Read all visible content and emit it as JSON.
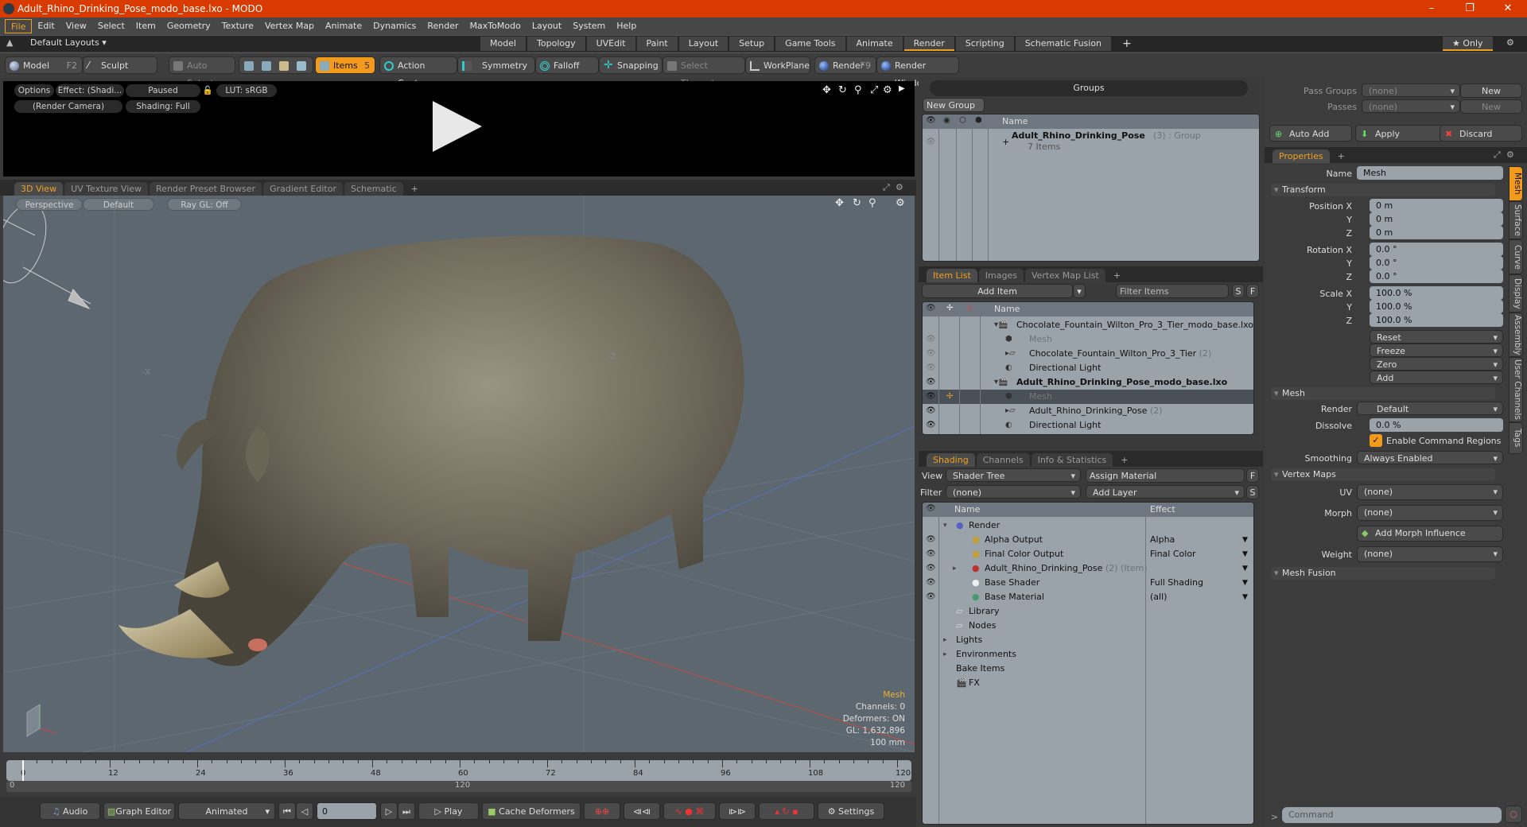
{
  "window": {
    "title": "Adult_Rhino_Drinking_Pose_modo_base.lxo - MODO",
    "controls": [
      "–",
      "❐",
      "✕"
    ]
  },
  "menu": [
    "File",
    "Edit",
    "View",
    "Select",
    "Item",
    "Geometry",
    "Texture",
    "Vertex Map",
    "Animate",
    "Dynamics",
    "Render",
    "MaxToModo",
    "Layout",
    "System",
    "Help"
  ],
  "layouts": {
    "label": "Default Layouts ▾",
    "tabs": [
      "Model",
      "Topology",
      "UVEdit",
      "Paint",
      "Layout",
      "Setup",
      "Game Tools",
      "Animate",
      "Render",
      "Scripting",
      "Schematic Fusion",
      "+"
    ],
    "active": "Render",
    "only_label": "★ Only"
  },
  "toolbar": {
    "model": "Model",
    "model_key": "F2",
    "sculpt": "Sculpt",
    "auto_select": "Auto Select",
    "items": "Items",
    "items_key": "5",
    "action_center": "Action Center",
    "symmetry": "Symmetry",
    "falloff": "Falloff",
    "snapping": "Snapping",
    "select_through": "Select Through",
    "workplane": "WorkPlane",
    "render": "Render",
    "render_key": "F9",
    "render_window": "Render Window"
  },
  "preview": {
    "options": "Options",
    "effect": "Effect: (Shadi...",
    "paused": "Paused",
    "lut": "LUT: sRGB",
    "camera": "(Render Camera)",
    "shading": "Shading: Full"
  },
  "viewport_tabs": [
    "3D View",
    "UV Texture View",
    "Render Preset Browser",
    "Gradient Editor",
    "Schematic",
    "+"
  ],
  "viewport": {
    "perspective": "Perspective",
    "default": "Default",
    "raygl": "Ray GL: Off",
    "axis_x_neg": "-X",
    "axis_z_neg": "-Z",
    "info": {
      "title": "Mesh",
      "channels": "Channels: 0",
      "deformers": "Deformers: ON",
      "gl": "GL: 1,632,896",
      "scale": "100 mm"
    }
  },
  "timeline": {
    "ticks": [
      "0",
      "12",
      "24",
      "36",
      "48",
      "60",
      "72",
      "84",
      "96",
      "108",
      "120"
    ],
    "range_start": "0",
    "range_mid": "120",
    "range_end": "120"
  },
  "transport": {
    "audio": "Audio",
    "graph_editor": "Graph Editor",
    "animated": "Animated",
    "frame": "0",
    "play": "Play",
    "cache_deformers": "Cache Deformers",
    "settings": "Settings"
  },
  "groups": {
    "title": "Groups",
    "new_group": "New Group",
    "name_header": "Name",
    "item_name": "Adult_Rhino_Drinking_Pose",
    "item_count": "(3)",
    "item_type": ": Group",
    "item_sub": "7 Items"
  },
  "item_list": {
    "tabs": [
      "Item List",
      "Images",
      "Vertex Map List",
      "+"
    ],
    "add_item": "Add Item",
    "filter_placeholder": "Filter Items",
    "s": "S",
    "f": "F",
    "name_header": "Name",
    "rows": [
      {
        "name": "Chocolate_Fountain_Wilton_Pro_3_Tier_modo_base.lxo",
        "extra": "",
        "indent": 0,
        "bold": false
      },
      {
        "name": "Mesh",
        "extra": "",
        "indent": 1,
        "bold": false,
        "dim": true
      },
      {
        "name": "Chocolate_Fountain_Wilton_Pro_3_Tier",
        "extra": "(2)",
        "indent": 1,
        "bold": false
      },
      {
        "name": "Directional Light",
        "extra": "",
        "indent": 1,
        "bold": false
      },
      {
        "name": "Adult_Rhino_Drinking_Pose_modo_base.lxo",
        "extra": "",
        "indent": 0,
        "bold": true
      },
      {
        "name": "Mesh",
        "extra": "",
        "indent": 1,
        "bold": false,
        "dim": true,
        "selected": true
      },
      {
        "name": "Adult_Rhino_Drinking_Pose",
        "extra": "(2)",
        "indent": 1,
        "bold": false
      },
      {
        "name": "Directional Light",
        "extra": "",
        "indent": 1,
        "bold": false
      }
    ]
  },
  "shading": {
    "tabs": [
      "Shading",
      "Channels",
      "Info & Statistics",
      "+"
    ],
    "view_label": "View",
    "view_value": "Shader Tree",
    "assign_material": "Assign Material",
    "filter_label": "Filter",
    "filter_value": "(none)",
    "add_layer": "Add Layer",
    "f": "F",
    "s": "S",
    "name_header": "Name",
    "effect_header": "Effect",
    "rows": [
      {
        "name": "Render",
        "extra": "",
        "effect": "",
        "indent": 0
      },
      {
        "name": "Alpha Output",
        "extra": "",
        "effect": "Alpha",
        "indent": 1
      },
      {
        "name": "Final Color Output",
        "extra": "",
        "effect": "Final Color",
        "indent": 1
      },
      {
        "name": "Adult_Rhino_Drinking_Pose",
        "extra": "(2) (Item)",
        "effect": "",
        "indent": 1
      },
      {
        "name": "Base Shader",
        "extra": "",
        "effect": "Full Shading",
        "indent": 1
      },
      {
        "name": "Base Material",
        "extra": "",
        "effect": "(all)",
        "indent": 1
      },
      {
        "name": "Library",
        "extra": "",
        "effect": "",
        "indent": 0
      },
      {
        "name": "Nodes",
        "extra": "",
        "effect": "",
        "indent": 0
      },
      {
        "name": "Lights",
        "extra": "",
        "effect": "",
        "indent": 0
      },
      {
        "name": "Environments",
        "extra": "",
        "effect": "",
        "indent": 0
      },
      {
        "name": "Bake Items",
        "extra": "",
        "effect": "",
        "indent": 0
      },
      {
        "name": "FX",
        "extra": "",
        "effect": "",
        "indent": 0
      }
    ]
  },
  "passes": {
    "pass_groups_label": "Pass Groups",
    "pass_groups_value": "(none)",
    "passes_label": "Passes",
    "passes_value": "(none)",
    "new": "New",
    "auto_add": "Auto Add",
    "apply": "Apply",
    "discard": "Discard"
  },
  "properties": {
    "tab": "Properties",
    "name_label": "Name",
    "name_value": "Mesh",
    "transform": "Transform",
    "position_label": "Position X",
    "position": [
      "0 m",
      "0 m",
      "0 m"
    ],
    "rotation_label": "Rotation X",
    "rotation": [
      "0.0 °",
      "0.0 °",
      "0.0 °"
    ],
    "scale_label": "Scale X",
    "scale": [
      "100.0 %",
      "100.0 %",
      "100.0 %"
    ],
    "y": "Y",
    "z": "Z",
    "actions": [
      "Reset",
      "Freeze",
      "Zero",
      "Add"
    ],
    "mesh_section": "Mesh",
    "render_label": "Render",
    "render_value": "Default",
    "dissolve_label": "Dissolve",
    "dissolve_value": "0.0 %",
    "enable_cmd_regions": "Enable Command Regions",
    "smoothing_label": "Smoothing",
    "smoothing_value": "Always Enabled",
    "vertex_maps": "Vertex Maps",
    "uv_label": "UV",
    "uv_value": "(none)",
    "morph_label": "Morph",
    "morph_value": "(none)",
    "add_morph": "Add Morph Influence",
    "weight_label": "Weight",
    "weight_value": "(none)",
    "mesh_fusion": "Mesh Fusion",
    "side_tabs": [
      "Mesh",
      "Surface",
      "Curve",
      "Display",
      "Assembly",
      "User Channels",
      "Tags"
    ]
  },
  "command": {
    "prompt": ">",
    "placeholder": "Command"
  }
}
